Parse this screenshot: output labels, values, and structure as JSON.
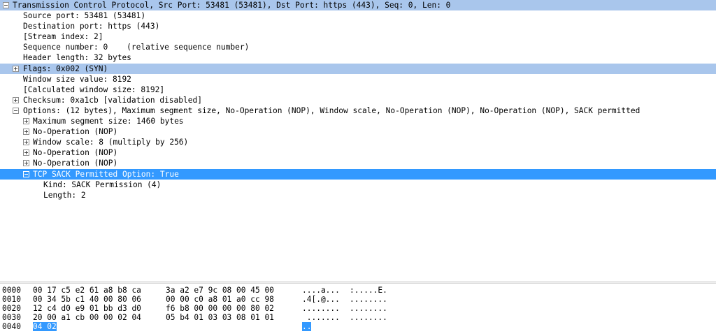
{
  "tree": [
    {
      "text": "Transmission Control Protocol, Src Port: 53481 (53481), Dst Port: https (443), Seq: 0, Len: 0",
      "level": 0,
      "toggle": "minus",
      "sel": "light"
    },
    {
      "text": "Source port: 53481 (53481)",
      "level": 1
    },
    {
      "text": "Destination port: https (443)",
      "level": 1
    },
    {
      "text": "[Stream index: 2]",
      "level": 1
    },
    {
      "text": "Sequence number: 0    (relative sequence number)",
      "level": 1
    },
    {
      "text": "Header length: 32 bytes",
      "level": 1
    },
    {
      "text": "Flags: 0x002 (SYN)",
      "level": 1,
      "toggle": "plus",
      "sel": "light"
    },
    {
      "text": "Window size value: 8192",
      "level": 1
    },
    {
      "text": "[Calculated window size: 8192]",
      "level": 1
    },
    {
      "text": "Checksum: 0xa1cb [validation disabled]",
      "level": 1,
      "toggle": "plus"
    },
    {
      "text": "Options: (12 bytes), Maximum segment size, No-Operation (NOP), Window scale, No-Operation (NOP), No-Operation (NOP), SACK permitted",
      "level": 1,
      "toggle": "minus"
    },
    {
      "text": "Maximum segment size: 1460 bytes",
      "level": 2,
      "toggle": "plus"
    },
    {
      "text": "No-Operation (NOP)",
      "level": 2,
      "toggle": "plus"
    },
    {
      "text": "Window scale: 8 (multiply by 256)",
      "level": 2,
      "toggle": "plus"
    },
    {
      "text": "No-Operation (NOP)",
      "level": 2,
      "toggle": "plus"
    },
    {
      "text": "No-Operation (NOP)",
      "level": 2,
      "toggle": "plus"
    },
    {
      "text": "TCP SACK Permitted Option: True",
      "level": 2,
      "toggle": "minus",
      "sel": "dark"
    },
    {
      "text": "Kind: SACK Permission (4)",
      "level": 3
    },
    {
      "text": "Length: 2",
      "level": 3
    }
  ],
  "hex": [
    {
      "offset": "0000",
      "bytes1": "00 17 c5 e2 61 a8 b8 ca",
      "bytes2": "3a a2 e7 9c 08 00 45 00",
      "ascii1": "....a...",
      "ascii2": ":.....E."
    },
    {
      "offset": "0010",
      "bytes1": "00 34 5b c1 40 00 80 06",
      "bytes2": "00 00 c0 a8 01 a0 cc 98",
      "ascii1": ".4[.@...",
      "ascii2": "........"
    },
    {
      "offset": "0020",
      "bytes1": "12 c4 d0 e9 01 bb d3 d0",
      "bytes2": "f6 b8 00 00 00 00 80 02",
      "ascii1": "........",
      "ascii2": "........"
    },
    {
      "offset": "0030",
      "bytes1": "20 00 a1 cb 00 00 02 04",
      "bytes2": "05 b4 01 03 03 08 01 01",
      "ascii1": " .......",
      "ascii2": "........"
    },
    {
      "offset": "0040",
      "bytes1": "04 02",
      "bytes2": "",
      "ascii1": "..",
      "ascii2": "",
      "selected": true
    }
  ]
}
